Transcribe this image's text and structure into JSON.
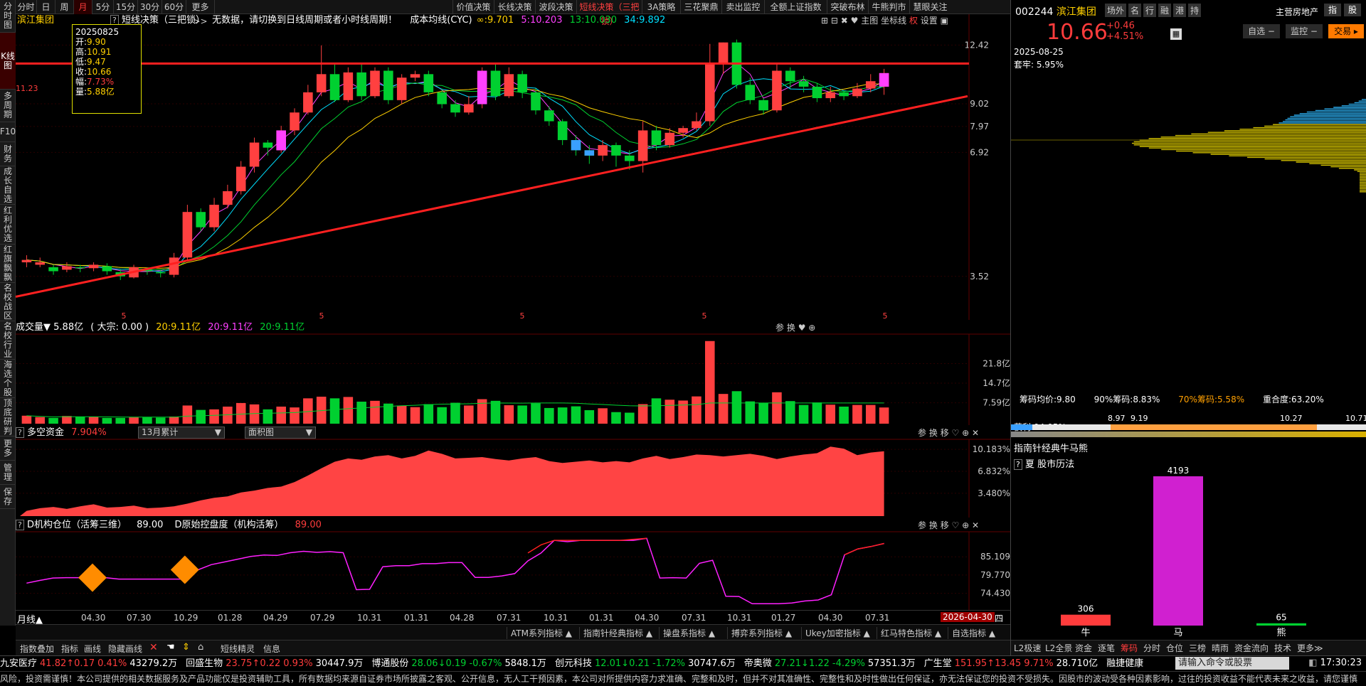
{
  "left_nav": [
    "分时图",
    "K线图",
    "多周期",
    "F10",
    "财务",
    "成长自选",
    "红利优选",
    "红旗飘飘",
    "名校战区",
    "名校行业",
    "海选个股",
    "顶底研判",
    "更多",
    "管理",
    "保存"
  ],
  "period_tabs": [
    "分时",
    "日",
    "周",
    "月",
    "5分",
    "15分",
    "30分",
    "60分",
    "更多>>"
  ],
  "active_period": "月",
  "strategy_tabs": [
    "价值决策",
    "长线决策",
    "波段决策",
    "短线决策（三把锁）",
    "3A策略",
    "三花聚鼎",
    "卖出监控",
    "全额上证指数",
    "突破布林",
    "牛熊判市",
    "慧眼关注"
  ],
  "main": {
    "stock_name": "滨江集团",
    "indicator_label": "短线决策（三把锁）",
    "notice": "无数据，请切换到日线周期或者小时线周期！",
    "cyc_label": "成本均线(CYC)",
    "cyc_values": [
      "∞:9.701",
      "5:10.203",
      "13:10.030",
      "34:9.892"
    ],
    "right_tools": [
      "主图",
      "坐标线",
      "权",
      "设置"
    ],
    "tooltip": {
      "date": "20250825",
      "open_label": "开:",
      "open": "9.90",
      "high_label": "高:",
      "high": "10.91",
      "low_label": "低:",
      "low": "9.47",
      "close_label": "收:",
      "close": "10.66",
      "chg_label": "幅:",
      "chg": "7.73%",
      "vol_label": "量:",
      "vol": "5.88亿"
    },
    "price_marker": "11.23",
    "y_ticks": [
      "12.42",
      "9.02",
      "7.97",
      "6.92",
      "3.52"
    ]
  },
  "chart_data": [
    {
      "type": "bar",
      "name": "月K线",
      "candles": [
        [
          3.8,
          3.85,
          3.7,
          3.95
        ],
        [
          3.75,
          3.8,
          3.7,
          3.9
        ],
        [
          3.7,
          3.62,
          3.55,
          3.75
        ],
        [
          3.65,
          3.72,
          3.6,
          3.8
        ],
        [
          3.7,
          3.68,
          3.6,
          3.75
        ],
        [
          3.68,
          3.75,
          3.62,
          3.8
        ],
        [
          3.72,
          3.62,
          3.55,
          3.78
        ],
        [
          3.6,
          3.52,
          3.45,
          3.65
        ],
        [
          3.5,
          3.7,
          3.48,
          3.75
        ],
        [
          3.65,
          3.62,
          3.55,
          3.7
        ],
        [
          3.6,
          3.58,
          3.5,
          3.65
        ],
        [
          3.55,
          3.9,
          3.5,
          4.0
        ],
        [
          3.9,
          5.0,
          3.85,
          5.2
        ],
        [
          5.0,
          4.6,
          4.5,
          5.1
        ],
        [
          4.6,
          5.2,
          4.5,
          5.4
        ],
        [
          5.2,
          5.6,
          5.1,
          5.8
        ],
        [
          5.6,
          6.4,
          5.5,
          6.6
        ],
        [
          6.4,
          7.3,
          6.2,
          7.5
        ],
        [
          7.3,
          7.1,
          6.8,
          7.4
        ],
        [
          7.0,
          7.8,
          6.9,
          8.0
        ],
        [
          7.8,
          8.6,
          7.6,
          8.8
        ],
        [
          8.6,
          9.6,
          8.5,
          10.0
        ],
        [
          9.6,
          10.6,
          9.4,
          12.4
        ],
        [
          10.6,
          9.2,
          9.1,
          11.2
        ],
        [
          9.2,
          10.7,
          9.1,
          11.0
        ],
        [
          10.7,
          9.4,
          9.2,
          11.2
        ],
        [
          9.4,
          10.8,
          9.3,
          11.0
        ],
        [
          10.8,
          9.2,
          9.0,
          11.0
        ],
        [
          9.2,
          10.4,
          9.0,
          10.6
        ],
        [
          10.4,
          10.6,
          10.2,
          10.8
        ],
        [
          10.6,
          9.6,
          9.4,
          10.8
        ],
        [
          9.6,
          9.0,
          8.8,
          9.8
        ],
        [
          9.0,
          8.6,
          8.4,
          9.2
        ],
        [
          8.6,
          9.0,
          8.5,
          9.4
        ],
        [
          9.0,
          10.8,
          8.8,
          11.0
        ],
        [
          10.8,
          9.4,
          9.2,
          11.2
        ],
        [
          9.4,
          10.6,
          9.3,
          11.0
        ],
        [
          10.6,
          9.6,
          9.3,
          10.8
        ],
        [
          9.6,
          8.7,
          8.5,
          9.8
        ],
        [
          8.7,
          8.2,
          8.0,
          8.9
        ],
        [
          8.2,
          7.4,
          7.2,
          8.3
        ],
        [
          7.4,
          7.0,
          6.8,
          7.6
        ],
        [
          7.0,
          6.8,
          6.5,
          7.2
        ],
        [
          6.8,
          7.2,
          6.6,
          7.4
        ],
        [
          7.2,
          6.8,
          6.4,
          7.3
        ],
        [
          6.8,
          6.6,
          6.3,
          7.0
        ],
        [
          6.6,
          7.8,
          6.2,
          8.2
        ],
        [
          7.8,
          7.2,
          7.0,
          8.0
        ],
        [
          7.2,
          7.7,
          7.1,
          7.9
        ],
        [
          7.7,
          7.9,
          7.5,
          8.0
        ],
        [
          7.9,
          8.2,
          7.8,
          8.6
        ],
        [
          8.2,
          11.2,
          8.0,
          12.5
        ],
        [
          11.2,
          12.6,
          10.6,
          12.6
        ],
        [
          12.6,
          10.0,
          9.8,
          12.8
        ],
        [
          10.0,
          9.2,
          9.0,
          10.4
        ],
        [
          9.2,
          8.7,
          8.5,
          9.3
        ],
        [
          8.7,
          10.8,
          8.6,
          11.2
        ],
        [
          10.8,
          10.2,
          9.8,
          11.0
        ],
        [
          10.2,
          9.9,
          9.6,
          10.5
        ],
        [
          9.9,
          9.3,
          9.1,
          10.1
        ],
        [
          9.3,
          9.6,
          9.1,
          9.9
        ],
        [
          9.6,
          9.4,
          9.2,
          9.7
        ],
        [
          9.4,
          9.8,
          9.3,
          10.1
        ],
        [
          9.8,
          10.2,
          9.6,
          10.6
        ],
        [
          9.9,
          10.66,
          9.47,
          10.91
        ]
      ],
      "annotations": [
        "5",
        "5",
        "5",
        "5",
        "5"
      ]
    },
    {
      "type": "bar",
      "name": "成交量",
      "title": "成交量▼",
      "values": [
        2.9,
        2.4,
        2.1,
        2.8,
        2.5,
        2.5,
        2.1,
        2.1,
        2.3,
        2.3,
        2.2,
        2.6,
        6.6,
        5.0,
        5.2,
        6.2,
        7.5,
        7.0,
        5.2,
        6.2,
        5.9,
        9.2,
        9.8,
        9.2,
        9.7,
        8.0,
        8.3,
        7.3,
        6.6,
        6.0,
        7.1,
        6.0,
        7.6,
        6.6,
        8.9,
        8.3,
        6.7,
        6.6,
        7.4,
        5.7,
        5.9,
        6.3,
        4.9,
        5.6,
        4.2,
        4.0,
        7.1,
        9.2,
        8.7,
        8.4,
        9.9,
        30.0,
        10.8,
        11.8,
        8.1,
        7.6,
        11.4,
        8.2,
        6.8,
        7.7,
        6.9,
        6.2,
        6.8,
        6.8,
        5.88
      ]
    },
    {
      "type": "area",
      "name": "多空资金",
      "values": [
        0.8,
        1.2,
        1.4,
        1.1,
        1.5,
        1.8,
        1.3,
        1.4,
        1.6,
        1.2,
        1.3,
        1.5,
        1.9,
        2.4,
        2.8,
        3.0,
        3.6,
        3.9,
        4.3,
        4.5,
        5.2,
        6.2,
        7.3,
        8.3,
        8.8,
        8.6,
        9.1,
        9.3,
        8.8,
        9.2,
        10.0,
        9.5,
        8.8,
        8.9,
        9.0,
        8.7,
        8.5,
        8.8,
        9.0,
        8.4,
        8.1,
        8.3,
        8.5,
        8.2,
        8.4,
        8.2,
        8.8,
        9.2,
        8.7,
        9.0,
        9.4,
        9.3,
        9.1,
        9.3,
        9.5,
        9.2,
        8.7,
        9.1,
        9.4,
        9.6,
        10.6,
        10.3,
        9.3,
        9.7,
        9.9
      ]
    },
    {
      "type": "line",
      "name": "D机构仓位",
      "values": [
        77.4,
        78.2,
        78.9,
        79.0,
        79.0,
        79.0,
        79.0,
        78.6,
        78.6,
        78.6,
        78.6,
        78.6,
        78.6,
        81.3,
        82.8,
        83.6,
        84.4,
        85.2,
        85.6,
        85.5,
        86.3,
        86.7,
        86.4,
        86.6,
        86.3,
        75.5,
        75.6,
        82.2,
        82.5,
        82.5,
        83.1,
        83.1,
        83.4,
        83.4,
        79.1,
        79.1,
        79.5,
        80.2,
        83.9,
        86.2,
        89.9,
        89.5,
        89.9,
        89.9,
        89.9,
        89.9,
        89.9,
        90.5,
        78.9,
        79.0,
        78.9,
        83.2,
        84.1,
        73.6,
        73.5,
        71.4,
        71.4,
        71.4,
        71.6,
        72.2,
        72.5,
        74.0,
        85.7,
        87.4,
        88.1,
        89.0
      ]
    }
  ],
  "volume_panel": {
    "title": "成交量▼",
    "value": "5.88亿",
    "big": "( 大宗: 0.00 )",
    "ma": [
      "20:9.11亿",
      "20:9.11亿",
      "20:9.11亿"
    ],
    "y_ticks": [
      "21.8亿",
      "14.7亿",
      "7.59亿"
    ]
  },
  "dkzj_panel": {
    "title": "多空资金",
    "value": "7.904%",
    "select1": "13月累计",
    "select2": "面积图",
    "y_ticks": [
      "10.183%",
      "6.832%",
      "3.480%"
    ]
  },
  "dinst_panel": {
    "title": "D机构仓位（活筹三维）",
    "value": "89.00",
    "title2": "D原始控盘度（机构活筹）",
    "value2": "89.00",
    "y_ticks": [
      "85.109",
      "79.770",
      "74.430"
    ]
  },
  "x_axis": {
    "label": "月线▲",
    "dates": [
      "04.30",
      "07.30",
      "10.29",
      "01.28",
      "04.29",
      "07.29",
      "10.31",
      "01.31",
      "04.28",
      "07.31",
      "10.31",
      "01.31",
      "04.30",
      "07.31",
      "10.31",
      "01.27",
      "04.30",
      "07.31"
    ],
    "range_end": "2026-04-30"
  },
  "indicator_tabs": [
    "ATM系列指标 ▲",
    "指南针经典指标 ▲",
    "操盘系指标 ▲",
    "搏弈系列指标 ▲",
    "Ukey加密指标 ▲",
    "红马特色指标 ▲",
    "自选指标 ▲"
  ],
  "toolbar": [
    "指数叠加",
    "指标",
    "画线",
    "隐藏画线",
    "短线精灵",
    "信息"
  ],
  "ticker": [
    {
      "name": "九安医疗",
      "price": "41.82",
      "chg": "0.17",
      "pct": "0.41%",
      "amt": "43279.2万",
      "dir": "up"
    },
    {
      "name": "回盛生物",
      "price": "23.75",
      "chg": "0.22",
      "pct": "0.93%",
      "amt": "30447.9万",
      "dir": "up"
    },
    {
      "name": "博通股份",
      "price": "28.06",
      "chg": "0.19",
      "pct": "-0.67%",
      "amt": "5848.1万",
      "dir": "down"
    },
    {
      "name": "创元科技",
      "price": "12.01",
      "chg": "0.21",
      "pct": "-1.72%",
      "amt": "30747.6万",
      "dir": "down"
    },
    {
      "name": "帝奥微",
      "price": "27.21",
      "chg": "1.22",
      "pct": "-4.29%",
      "amt": "57351.3万",
      "dir": "down"
    },
    {
      "name": "广生堂",
      "price": "151.95",
      "chg": "13.45",
      "pct": "9.71%",
      "amt": "28.710亿",
      "dir": "up"
    },
    {
      "name": "融捷健康",
      "price": "",
      "chg": "",
      "pct": "",
      "amt": "",
      "dir": "up"
    }
  ],
  "command_placeholder": "请输入命令或股票",
  "clock": "17:30:23",
  "disclaimer": "风险，投资需谨慎！本公司提供的相关数据服务及产品功能仅是投资辅助工具，所有数据均来源自证券市场所披露之客观、公开信息，无人工干预因素，本公司对所提供内容力求准确、完整和及时，但并不对其准确性、完整性和及时性做出任何保证，亦无法保证您的投资不受损失。因股市的波动受各种因素影响，过往的投资收益不能代表未来之收益，请您谨慎",
  "right": {
    "code": "002244",
    "name": "滨江集团",
    "tags": [
      "场外",
      "名",
      "行",
      "融",
      "港",
      "持"
    ],
    "industry": "主营房地产",
    "btns_top": [
      "指",
      "股"
    ],
    "price": "10.66",
    "chg": "+0.46",
    "pct": "+4.51%",
    "btn_zixuan": "自选 −",
    "btn_jiankong": "监控 −",
    "btn_trade": "交易",
    "date": "2025-08-25",
    "tao": "套牢: 5.95%",
    "chip_avg_label": "筹码均价:",
    "chip_avg": "9.80",
    "chip90_label": "90%筹码:",
    "chip90": "8.83%",
    "chip70_label": "70%筹码:",
    "chip70": "5.58%",
    "overlap_label": "重合度:",
    "overlap": "63.20%",
    "profit_label": "获利:",
    "profit": "94.05%",
    "range": [
      "8.97",
      "9.19",
      "10.27",
      "10.71"
    ],
    "section_title": "指南针经典牛马熊",
    "section_sub": "夏  股市历法",
    "bull_bear": {
      "labels": [
        "牛",
        "马",
        "熊"
      ],
      "values": [
        306,
        4193,
        65
      ],
      "colors": [
        "#ff3c3c",
        "#d020d0",
        "#00d030"
      ]
    },
    "bottom_tabs": [
      "L2极速",
      "L2全景",
      "资金",
      "逐笔",
      "筹码",
      "分时",
      "仓位",
      "三榜",
      "晴雨",
      "资金流向",
      "技术",
      "更多≫"
    ],
    "active_bottom": "筹码"
  }
}
